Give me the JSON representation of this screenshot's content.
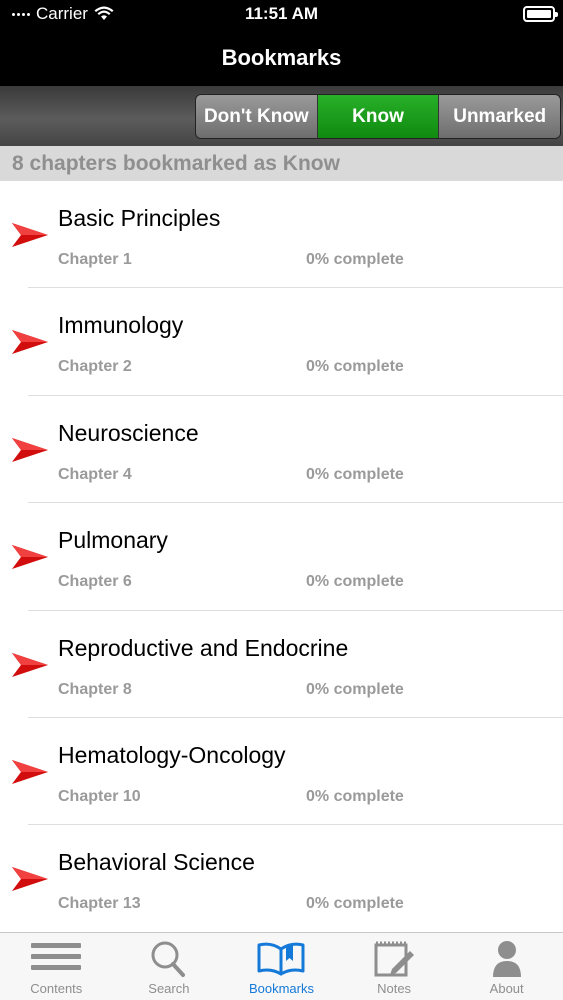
{
  "status": {
    "carrier": "Carrier",
    "time": "11:51 AM"
  },
  "nav": {
    "title": "Bookmarks"
  },
  "segments": [
    {
      "label": "Don't Know",
      "selected": false
    },
    {
      "label": "Know",
      "selected": true
    },
    {
      "label": "Unmarked",
      "selected": false
    }
  ],
  "section_header": "8 chapters bookmarked as Know",
  "chapters": [
    {
      "title": "Basic Principles",
      "chapter": "Chapter 1",
      "progress": "0% complete"
    },
    {
      "title": "Immunology",
      "chapter": "Chapter 2",
      "progress": "0% complete"
    },
    {
      "title": "Neuroscience",
      "chapter": "Chapter 4",
      "progress": "0% complete"
    },
    {
      "title": "Pulmonary",
      "chapter": "Chapter 6",
      "progress": "0% complete"
    },
    {
      "title": "Reproductive and Endocrine",
      "chapter": "Chapter 8",
      "progress": "0% complete"
    },
    {
      "title": "Hematology-Oncology",
      "chapter": "Chapter 10",
      "progress": "0% complete"
    },
    {
      "title": "Behavioral Science",
      "chapter": "Chapter 13",
      "progress": "0% complete"
    }
  ],
  "tabs": [
    {
      "label": "Contents",
      "icon": "list-icon",
      "active": false
    },
    {
      "label": "Search",
      "icon": "magnifier-icon",
      "active": false
    },
    {
      "label": "Bookmarks",
      "icon": "open-book-icon",
      "active": true
    },
    {
      "label": "Notes",
      "icon": "notepad-icon",
      "active": false
    },
    {
      "label": "About",
      "icon": "person-icon",
      "active": false
    }
  ],
  "colors": {
    "selected_segment": "#1e9e1e",
    "active_tab": "#1479d8",
    "arrow": "#d10d0d"
  }
}
